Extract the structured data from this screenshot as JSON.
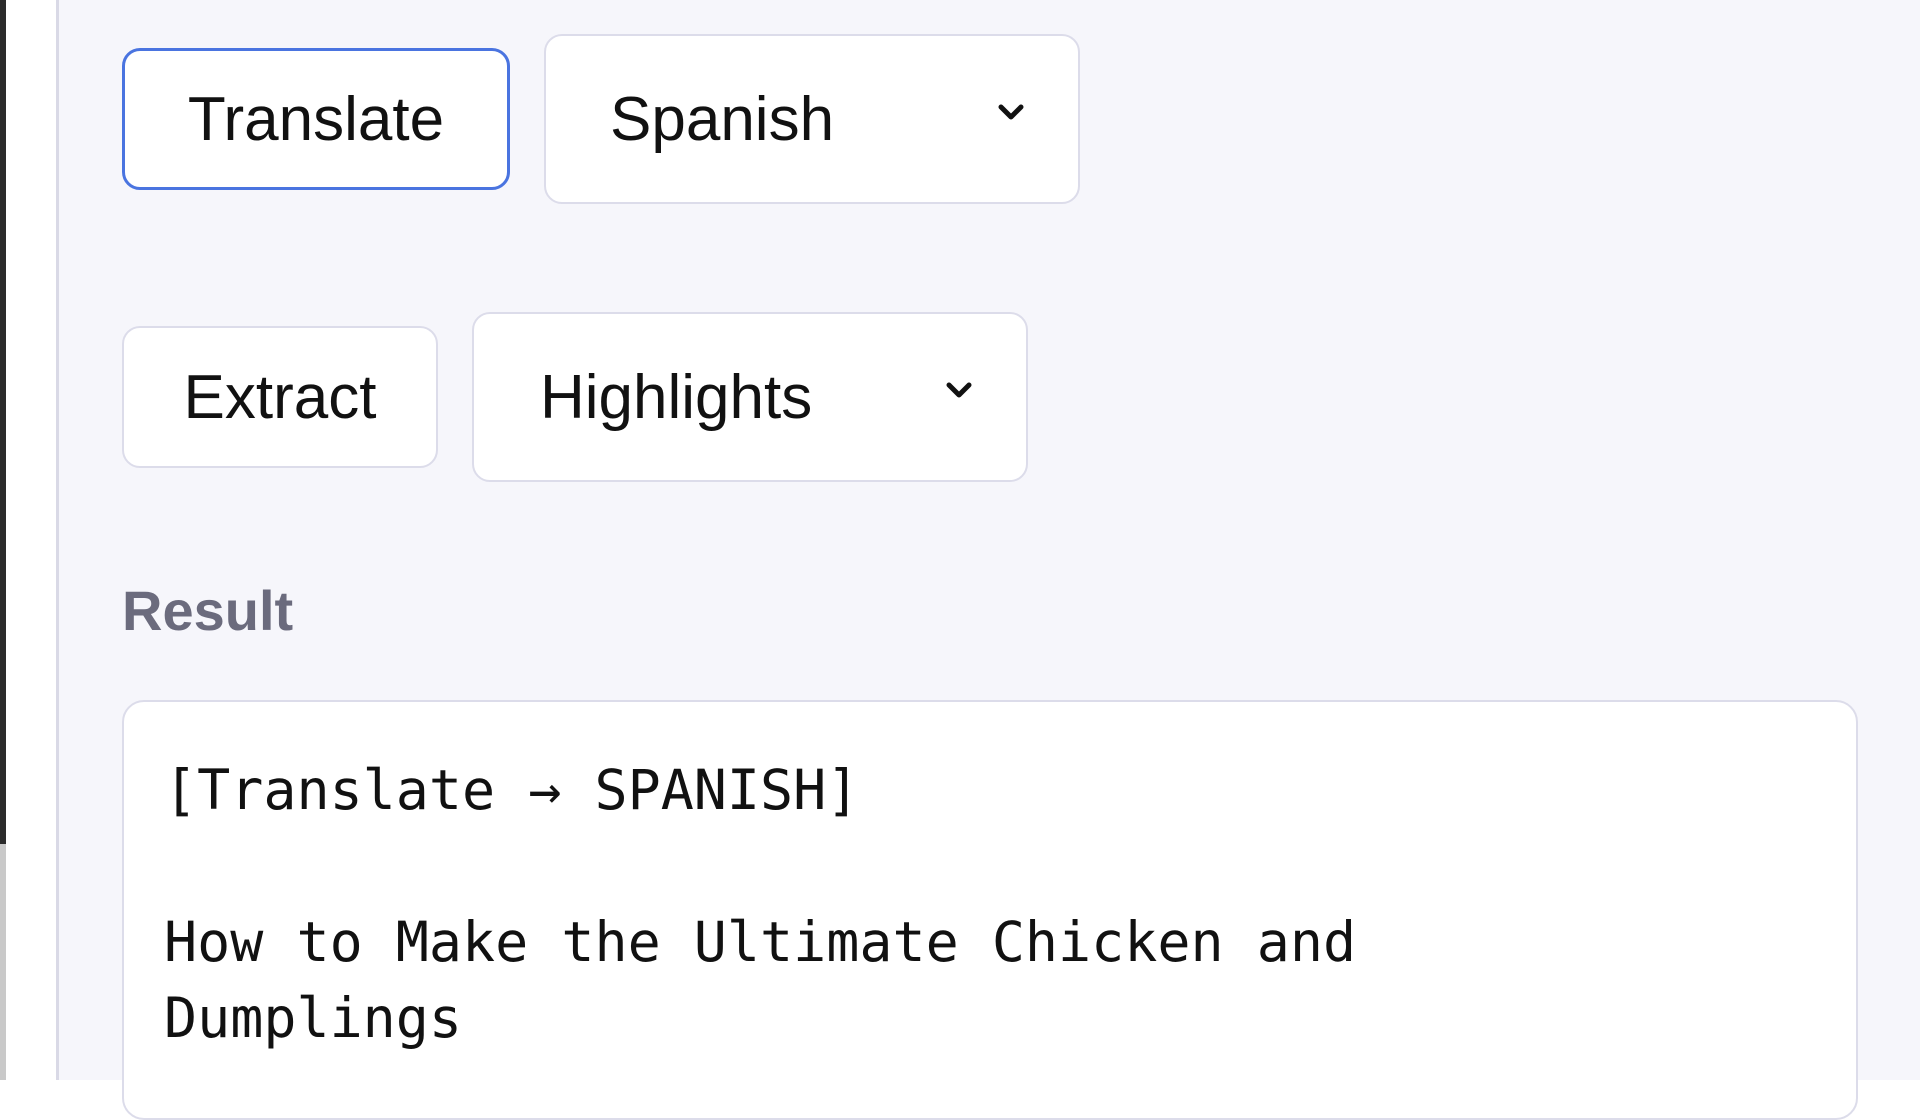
{
  "actions": {
    "translate": {
      "button_label": "Translate",
      "selected_option": "Spanish"
    },
    "extract": {
      "button_label": "Extract",
      "selected_option": "Highlights"
    }
  },
  "result": {
    "label": "Result",
    "header_line": "[Translate → SPANISH]",
    "title_line_1": "How to Make the Ultimate Chicken and",
    "title_line_2": "Dumplings"
  },
  "icons": {
    "dropdown": "chevron-down-icon"
  },
  "colors": {
    "focus_border": "#4a74e0",
    "panel_background": "#f6f6fb",
    "label_text": "#6b6b7d"
  }
}
